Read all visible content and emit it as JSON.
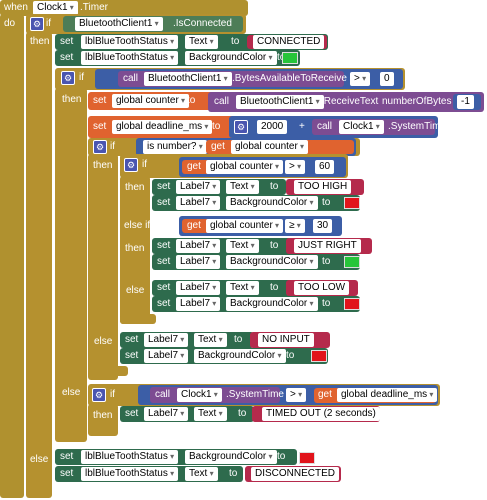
{
  "when": "when",
  "clock": "Clock1",
  "timer": ".Timer",
  "do": "do",
  "if": "if",
  "then": "then",
  "else": "else",
  "elseif": "else if",
  "set": "set",
  "to": "to",
  "call": "call",
  "get": "get",
  "gear": "⚙",
  "bt": "BluetoothClient1",
  "isconn": ".IsConnected",
  "lblstatus": "lblBlueToothStatus",
  "text": "Text",
  "bgcolor": "BackgroundColor",
  "connected": "CONNECTED",
  "disconnected": "DISCONNECTED",
  "bytesavail": ".BytesAvailableToReceive",
  "gt": ">",
  "ge": "≥",
  "zero": "0",
  "gcounter": "global counter",
  "gdeadline": "global deadline_ms",
  "receive": ".ReceiveText",
  "numbytes": "numberOfBytes",
  "neg1": "-1",
  "n2000": "2000",
  "plus": "+",
  "systime": ".SystemTime",
  "isnumber": "is number?",
  "n60": "60",
  "n30": "30",
  "label7": "Label7",
  "toohigh": "TOO HIGH",
  "justright": "JUST RIGHT",
  "toolow": "TOO LOW",
  "noinput": "NO INPUT",
  "timedout": "TIMED OUT (2 seconds)",
  "colors": {
    "green": "#27c53a",
    "red": "#e1141b"
  }
}
